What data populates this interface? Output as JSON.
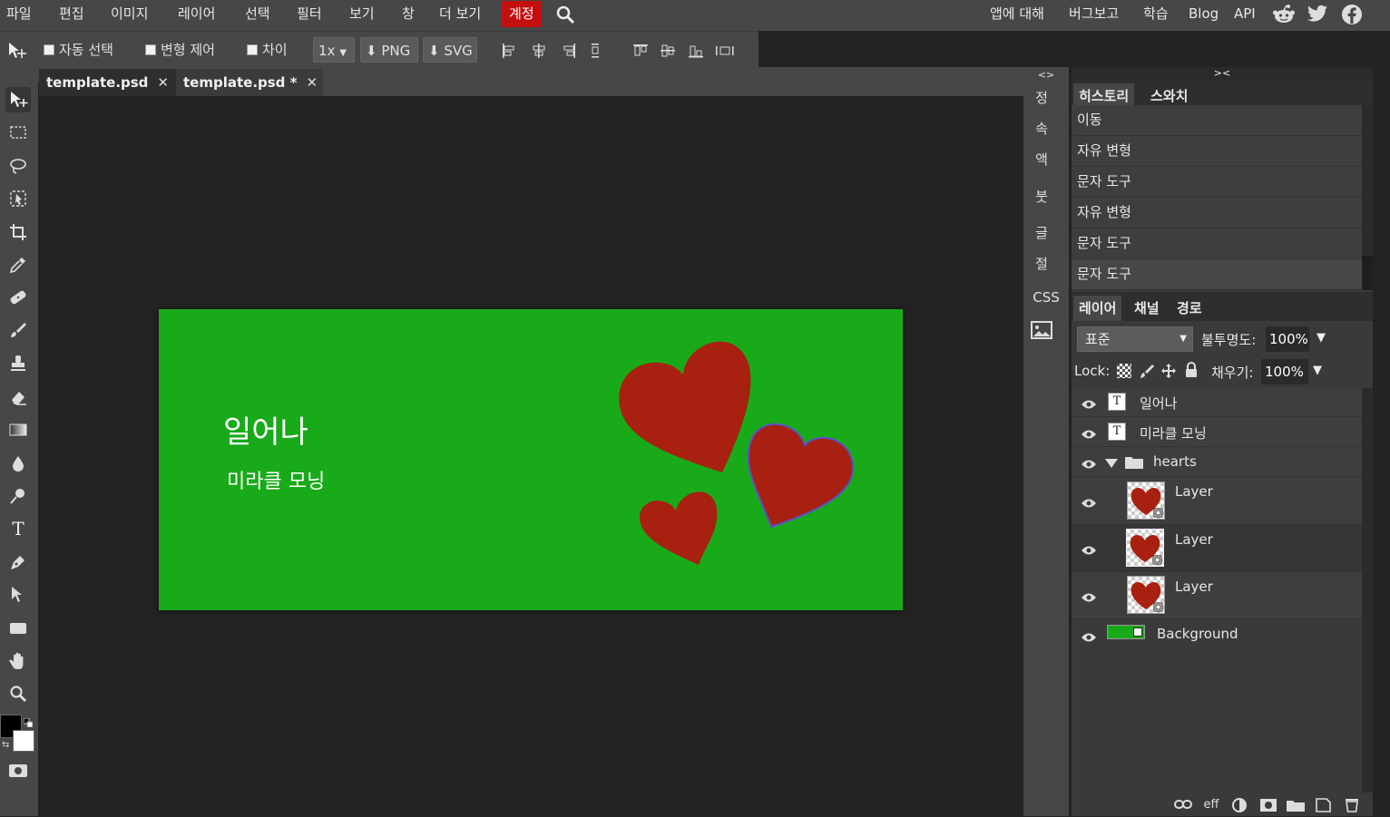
{
  "menu": {
    "items": [
      "파일",
      "편집",
      "이미지",
      "레이어",
      "선택",
      "필터",
      "보기",
      "창",
      "더 보기"
    ],
    "account": "계정",
    "right": [
      "앱에 대해",
      "버그보고",
      "학습",
      "Blog",
      "API"
    ]
  },
  "options": {
    "auto_select": "자동 선택",
    "transform_controls": "변형 제어",
    "diff": "차이",
    "zoom": "1x",
    "png": "PNG",
    "svg": "SVG"
  },
  "tabs": [
    {
      "label": "template.psd",
      "close": "✕"
    },
    {
      "label": "template.psd *",
      "close": "✕"
    }
  ],
  "canvas": {
    "title": "일어나",
    "subtitle": "미라클 모닝",
    "bg_color": "#19aa19",
    "heart_color": "#a8200f"
  },
  "mini": {
    "items": [
      "정",
      "속",
      "액",
      "붓",
      "글",
      "절"
    ],
    "css": "CSS",
    "collapse": "<>"
  },
  "panel": {
    "collapse": "><",
    "toolbar_collapse": "><",
    "history_tab": "히스토리",
    "swatch_tab": "스와치",
    "history": [
      "이동",
      "자유 변형",
      "문자 도구",
      "자유 변형",
      "문자 도구",
      "문자 도구"
    ],
    "layers_tab": "레이어",
    "channels_tab": "채널",
    "paths_tab": "경로",
    "blend": "표준",
    "opacity_label": "불투명도:",
    "opacity": "100%",
    "lock_label": "Lock:",
    "fill_label": "채우기:",
    "fill": "100%",
    "layers": [
      {
        "name": "일어나"
      },
      {
        "name": "미라클 모닝"
      },
      {
        "name": "hearts"
      },
      {
        "name": "Layer"
      },
      {
        "name": "Layer"
      },
      {
        "name": "Layer"
      },
      {
        "name": "Background"
      }
    ],
    "eff": "eff"
  }
}
